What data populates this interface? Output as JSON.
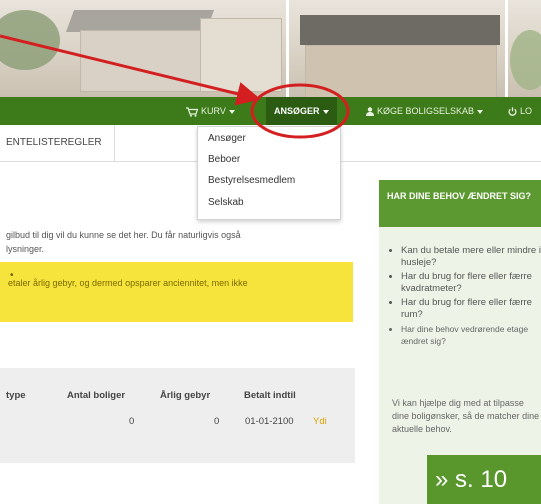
{
  "nav": {
    "cart_label": "KURV",
    "applicant_label": "ANSØGER",
    "housing_label": "KØGE BOLIGSELSKAB",
    "logout_label": "LO"
  },
  "subnav": {
    "tab_label": "ENTELISTEREGLER"
  },
  "dropdown": {
    "items": [
      {
        "label": "Ansøger"
      },
      {
        "label": "Beboer"
      },
      {
        "label": "Bestyrelsesmedlem"
      },
      {
        "label": "Selskab"
      }
    ]
  },
  "main": {
    "intro_line1": "gilbud til dig vil du kunne se det her. Du får naturligvis også",
    "intro_line2": "lysninger.",
    "warning_text": "etaler årlig gebyr, og dermed opsparer anciennitet, men ikke",
    "table": {
      "headers": [
        "type",
        "Antal boliger",
        "Årlig gebyr",
        "Betalt indtil"
      ],
      "row": {
        "boliger": "0",
        "gebyr": "0",
        "betalt": "01-01-2100",
        "link": "Ydi"
      }
    }
  },
  "sidebar": {
    "title": "HAR DINE BEHOV ÆNDRET SIG?",
    "bullets": [
      "Kan du betale mere eller mindre i husleje?",
      "Har du brug for flere eller færre kvadratmeter?",
      "Har du brug for flere eller færre rum?",
      "Har dine behov vedrørende etage ændret sig?"
    ],
    "paragraph": "Vi kan hjælpe dig med at tilpasse dine boligønsker, så de matcher dine aktuelle behov."
  },
  "page_ref": "» s. 10",
  "colors": {
    "nav_green": "#3d7a1a",
    "sidebar_green": "#5c9930",
    "warning_yellow": "#f6e43c",
    "annotation_red": "#d31f1f"
  },
  "icons": {
    "cart": "cart-icon",
    "user": "user-icon",
    "power": "power-icon"
  }
}
